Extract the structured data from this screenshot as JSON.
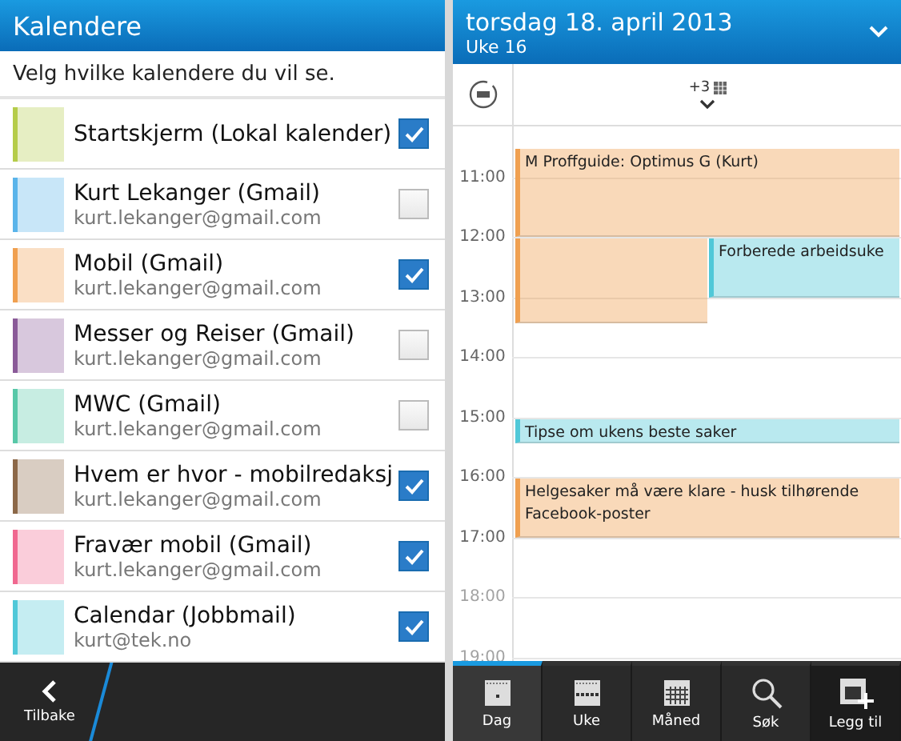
{
  "calendars_screen": {
    "title": "Kalendere",
    "instruction": "Velg hvilke kalendere du vil se.",
    "calendars": [
      {
        "name": "Startskjerm (Lokal kalender)",
        "color": "#b5cc4a",
        "checked": true
      },
      {
        "name": "Kurt Lekanger (Gmail)",
        "account": "kurt.lekanger@gmail.com",
        "color": "#5ab4ea",
        "checked": false
      },
      {
        "name": "Mobil (Gmail)",
        "account": "kurt.lekanger@gmail.com",
        "color": "#f0a050",
        "checked": true
      },
      {
        "name": "Messer og Reiser (Gmail)",
        "account": "kurt.lekanger@gmail.com",
        "color": "#8a5a98",
        "checked": false
      },
      {
        "name": "MWC (Gmail)",
        "account": "kurt.lekanger@gmail.com",
        "color": "#58c8a8",
        "checked": false
      },
      {
        "name": "Hvem er hvor - mobilredaksj",
        "account": "kurt.lekanger@gmail.com",
        "color": "#8c6848",
        "checked": true
      },
      {
        "name": "Fravær mobil (Gmail)",
        "account": "kurt.lekanger@gmail.com",
        "color": "#f06890",
        "checked": true
      },
      {
        "name": "Calendar (Jobbmail)",
        "account": "kurt@tek.no",
        "color": "#50c8d8",
        "checked": true
      }
    ],
    "back_button": "Tilbake"
  },
  "day_screen": {
    "date": "torsdag 18. april 2013",
    "week": "Uke 16",
    "more_count": "+3",
    "hours": [
      "11:00",
      "12:00",
      "13:00",
      "14:00",
      "15:00",
      "16:00",
      "17:00",
      "18:00",
      "19:00"
    ],
    "events": [
      {
        "title": "M Proffguide: Optimus G (Kurt)",
        "color": "#f0a050"
      },
      {
        "color": "#f0a050"
      },
      {
        "title": "Forberede arbeidsuke",
        "color": "#50c8d8"
      },
      {
        "title": "Tipse om ukens beste saker",
        "color": "#50c8d8"
      },
      {
        "title": "Helgesaker må være klare - husk tilhørende Facebook-poster",
        "color": "#f0a050"
      }
    ],
    "tabs": [
      {
        "label": "Dag",
        "kind": "day",
        "selected": true
      },
      {
        "label": "Uke",
        "kind": "week",
        "selected": false
      },
      {
        "label": "Måned",
        "kind": "month",
        "selected": false
      },
      {
        "label": "Søk",
        "kind": "search",
        "selected": false
      },
      {
        "label": "Legg til",
        "kind": "add",
        "selected": false
      }
    ]
  }
}
